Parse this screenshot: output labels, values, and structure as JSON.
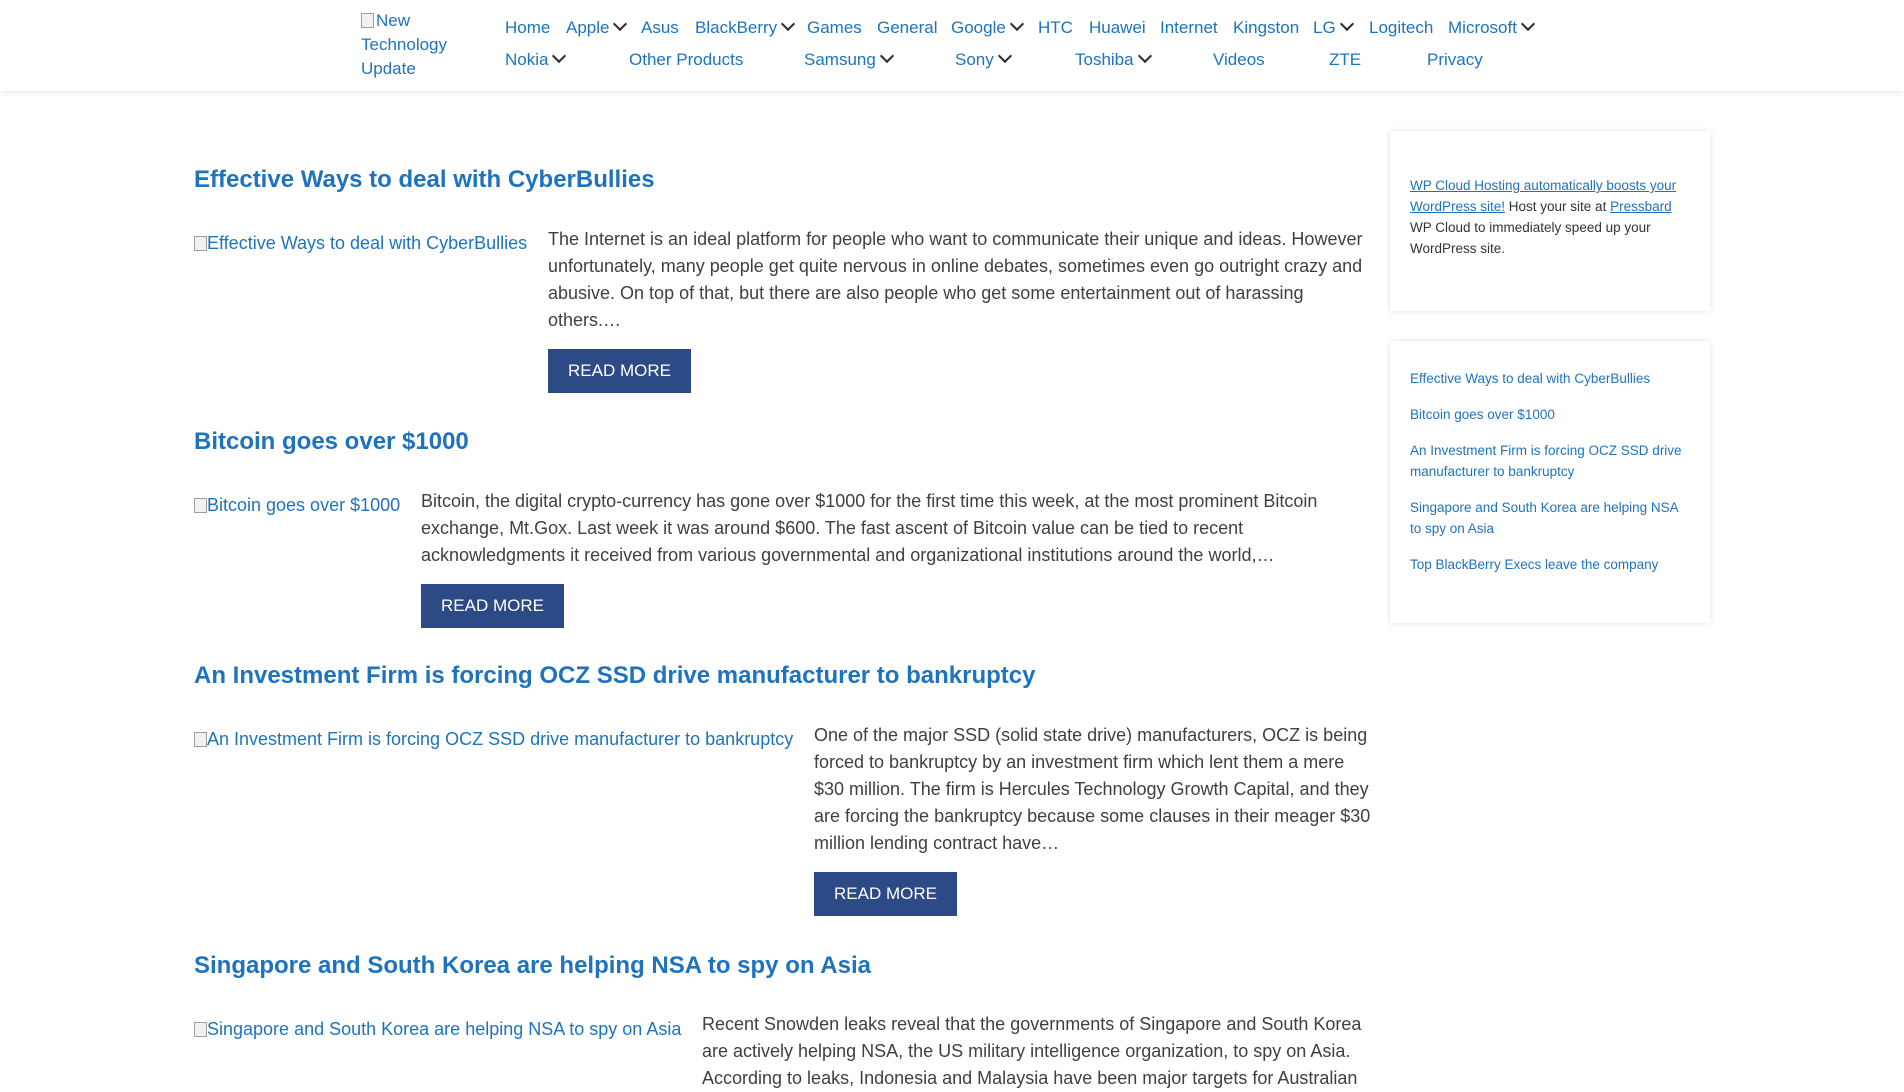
{
  "header": {
    "logo_alt": "New Technology Update",
    "nav": [
      {
        "label": "Home"
      },
      {
        "label": "Apple"
      },
      {
        "label": "Asus"
      },
      {
        "label": "BlackBerry"
      },
      {
        "label": "Games"
      },
      {
        "label": "General"
      },
      {
        "label": "Google"
      },
      {
        "label": "HTC"
      },
      {
        "label": "Huawei"
      },
      {
        "label": "Internet"
      },
      {
        "label": "Kingston"
      },
      {
        "label": "LG"
      },
      {
        "label": "Logitech"
      },
      {
        "label": "Microsoft"
      },
      {
        "label": "Nokia"
      },
      {
        "label": "Other Products"
      },
      {
        "label": "Samsung"
      },
      {
        "label": "Sony"
      },
      {
        "label": "Toshiba"
      },
      {
        "label": "Videos"
      },
      {
        "label": "ZTE"
      },
      {
        "label": "Privacy"
      }
    ]
  },
  "posts": [
    {
      "title": "Effective Ways to deal with CyberBullies",
      "image_alt": "Effective Ways to deal with CyberBullies",
      "excerpt": "The Internet is an ideal platform for people who want to communicate their unique and ideas. However unfortunately, many people get quite nervous in online debates, sometimes even go outright crazy and abusive. On top of that, but there are also people who get some entertainment out of harassing others.…",
      "read_more": "READ MORE"
    },
    {
      "title": "Bitcoin goes over $1000",
      "image_alt": "Bitcoin goes over $1000",
      "excerpt": "Bitcoin, the digital crypto-currency has gone over $1000 for the first time this week, at the most prominent Bitcoin exchange, Mt.Gox. Last week it was around $600. The fast ascent of Bitcoin value can be tied to recent acknowledgments it received from various governmental and organizational institutions around the world,…",
      "read_more": "READ MORE"
    },
    {
      "title": "An Investment Firm is forcing OCZ SSD drive manufacturer to bankruptcy",
      "image_alt": "An Investment Firm is forcing OCZ SSD drive manufacturer to bankruptcy",
      "excerpt": "One of the major SSD (solid state drive) manufacturers, OCZ is being forced to bankruptcy by an investment firm which lent them a mere $30 million. The firm is Hercules Technology Growth Capital, and they are forcing the bankruptcy because some clauses in their meager $30 million lending contract have…",
      "read_more": "READ MORE"
    },
    {
      "title": "Singapore and South Korea are helping NSA to spy on Asia",
      "image_alt": "Singapore and South Korea are helping NSA to spy on Asia",
      "excerpt": "Recent Snowden leaks reveal that the governments of Singapore and South Korea are actively helping NSA, the US military intelligence organization, to spy on Asia. According to leaks, Indonesia and Malaysia have been major targets for Australian"
    }
  ],
  "sidebar": {
    "ad": {
      "link1": "WP Cloud Hosting automatically boosts your WordPress site!",
      "text1": " Host your site at ",
      "link2": "Pressbard",
      "text2": " WP Cloud to immediately speed up your WordPress site."
    },
    "recent_posts": [
      "Effective Ways to deal with CyberBullies",
      "Bitcoin goes over $1000",
      "An Investment Firm is forcing OCZ SSD drive manufacturer to bankruptcy",
      "Singapore and South Korea are helping NSA to spy on Asia",
      "Top BlackBerry Execs leave the company"
    ]
  },
  "colors": {
    "link": "#1e73be",
    "button_bg": "#2c4a85",
    "text": "#404040"
  }
}
